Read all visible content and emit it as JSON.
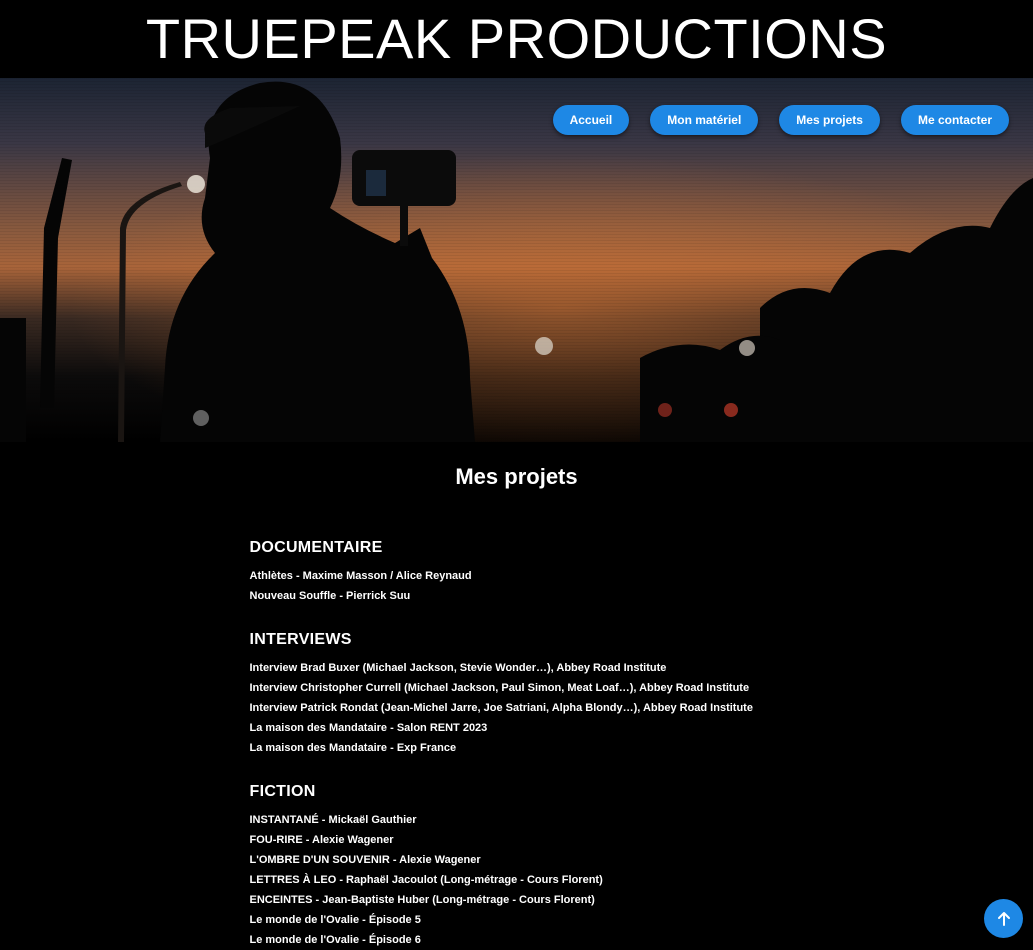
{
  "header": {
    "title": "TRUEPEAK PRODUCTIONS"
  },
  "nav": {
    "items": [
      {
        "label": "Accueil"
      },
      {
        "label": "Mon matériel"
      },
      {
        "label": "Mes projets"
      },
      {
        "label": "Me contacter"
      }
    ]
  },
  "main": {
    "title": "Mes projets",
    "sections": [
      {
        "heading": "DOCUMENTAIRE",
        "items": [
          "Athlètes - Maxime Masson / Alice Reynaud",
          "Nouveau Souffle - Pierrick Suu"
        ]
      },
      {
        "heading": "INTERVIEWS",
        "items": [
          "Interview Brad Buxer (Michael Jackson, Stevie Wonder…), Abbey Road Institute",
          "Interview Christopher Currell (Michael Jackson, Paul Simon, Meat Loaf…), Abbey Road Institute",
          "Interview Patrick Rondat (Jean-Michel Jarre, Joe Satriani, Alpha Blondy…), Abbey Road Institute",
          "La maison des Mandataire - Salon RENT 2023",
          "La maison des Mandataire - Exp France"
        ]
      },
      {
        "heading": "FICTION",
        "items": [
          "INSTANTANÉ - Mickaël Gauthier",
          "FOU-RIRE - Alexie Wagener",
          "L'OMBRE D'UN SOUVENIR - Alexie Wagener",
          "LETTRES À LEO - Raphaël Jacoulot (Long-métrage - Cours Florent)",
          "ENCEINTES - Jean-Baptiste Huber (Long-métrage - Cours Florent)",
          "Le monde de l'Ovalie - Épisode 5",
          "Le monde de l'Ovalie - Épisode 6"
        ]
      }
    ]
  },
  "back_to_top": {
    "icon": "arrow-up-icon"
  },
  "colors": {
    "accent": "#1e88e5",
    "background": "#000000",
    "text": "#ffffff"
  }
}
